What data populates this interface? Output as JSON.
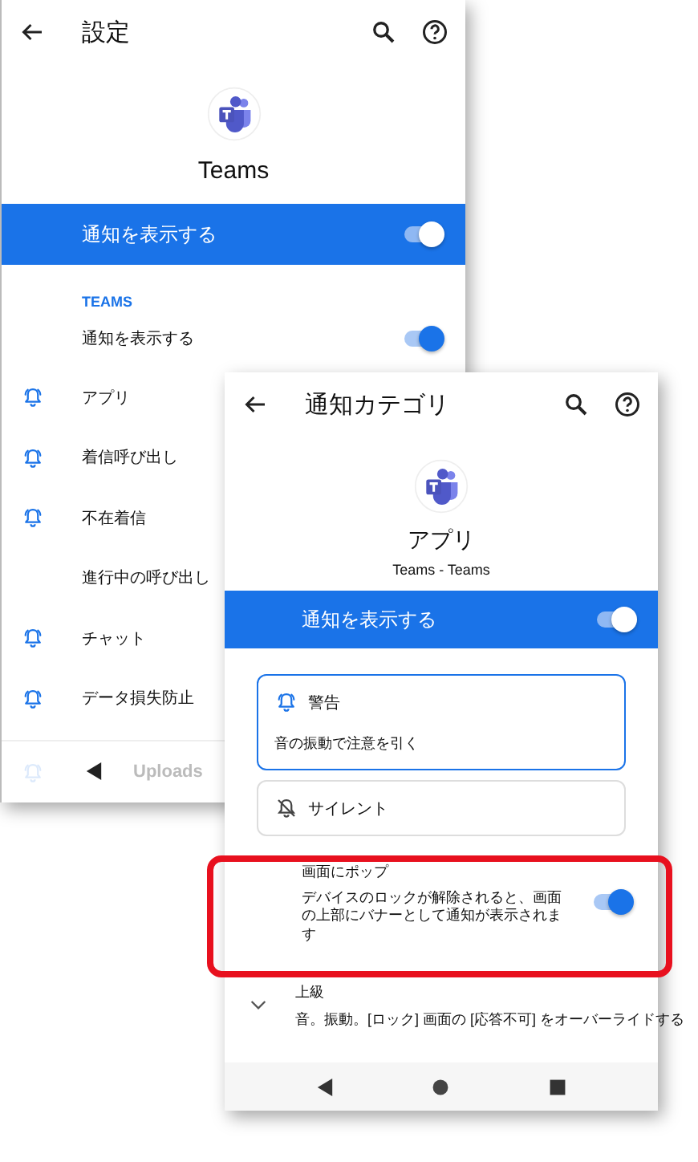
{
  "back_screen": {
    "title": "設定",
    "app_name": "Teams",
    "master_toggle": {
      "label": "通知を表示する",
      "on": true
    },
    "section": "TEAMS",
    "show_toggle": {
      "label": "通知を表示する",
      "on": true
    },
    "categories": [
      {
        "label": "アプリ",
        "kind": "bell"
      },
      {
        "label": "着信呼び出し",
        "kind": "bell"
      },
      {
        "label": "不在着信",
        "kind": "bell"
      },
      {
        "label": "進行中の呼び出し",
        "kind": "plain"
      },
      {
        "label": "チャット",
        "kind": "bell"
      },
      {
        "label": "データ損失防止",
        "kind": "bell"
      }
    ],
    "faded_row": {
      "label": "Uploads"
    }
  },
  "front_screen": {
    "title": "通知カテゴリ",
    "category": "アプリ",
    "subtitle": "Teams - Teams",
    "master_toggle": {
      "label": "通知を表示する",
      "on": true
    },
    "options": [
      {
        "kind": "alert",
        "label": "警告",
        "description": "音の振動で注意を引く",
        "selected": true
      },
      {
        "kind": "silent",
        "label": "サイレント",
        "selected": false
      }
    ],
    "popup": {
      "title": "画面にポップ",
      "description": "デバイスのロックが解除されると、画面の上部にバナーとして通知が表示されます",
      "on": true,
      "highlighted": true
    },
    "advanced": {
      "title": "上級",
      "description": "音。振動。[ロック] 画面の [応答不可] をオーバーライドする"
    }
  }
}
